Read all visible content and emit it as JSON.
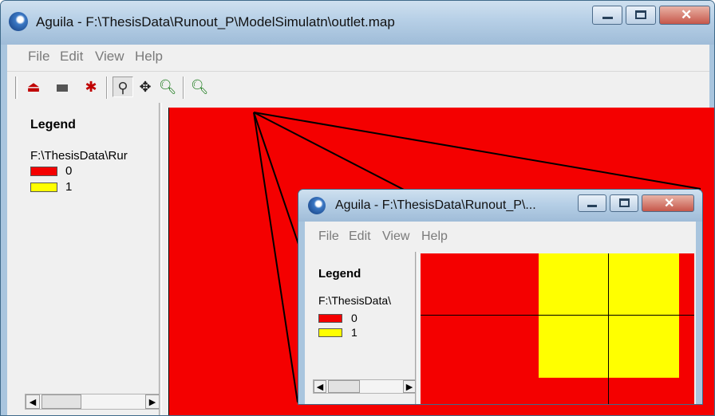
{
  "main": {
    "title": "Aguila - F:\\ThesisData\\Runout_P\\ModelSimulatn\\outlet.map",
    "menu": [
      "File",
      "Edit",
      "View",
      "Help"
    ],
    "legend_title": "Legend",
    "legend_path": "F:\\ThesisData\\Rur",
    "legend_items": [
      {
        "label": "0",
        "color": "#f40000"
      },
      {
        "label": "1",
        "color": "#ffff00"
      }
    ],
    "icons": [
      "screen-icon",
      "hide-icon",
      "tool-icon",
      "select-icon",
      "pan-icon",
      "zoom-in-icon",
      "zoom-out-icon"
    ]
  },
  "inset": {
    "title": "Aguila - F:\\ThesisData\\Runout_P\\...",
    "menu": [
      "File",
      "Edit",
      "View",
      "Help"
    ],
    "legend_title": "Legend",
    "legend_path": "F:\\ThesisData\\",
    "legend_items": [
      {
        "label": "0",
        "color": "#f40000"
      },
      {
        "label": "1",
        "color": "#ffff00"
      }
    ]
  },
  "colors": {
    "map_red": "#f40000",
    "map_yellow": "#ffff00",
    "chrome": "#a9c5de"
  }
}
